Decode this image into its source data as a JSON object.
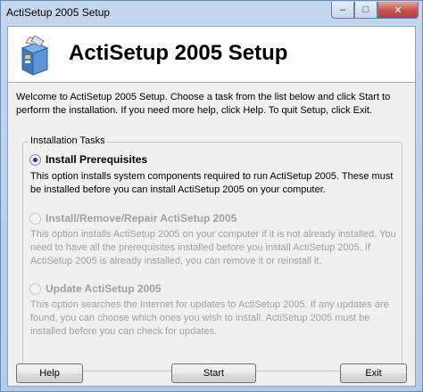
{
  "window": {
    "title": "ActiSetup 2005 Setup",
    "minimize_glyph": "–",
    "maximize_glyph": "□",
    "close_glyph": "✕"
  },
  "header": {
    "title": "ActiSetup 2005 Setup",
    "logo_icon": "box-install-icon"
  },
  "intro": "Welcome to ActiSetup 2005 Setup. Choose a task from the list below and click Start to perform the installation. If you need more help, click Help. To quit Setup, click Exit.",
  "tasks": {
    "legend": "Installation Tasks",
    "options": [
      {
        "label": "Install Prerequisites",
        "selected": true,
        "enabled": true,
        "description": "This option installs system components required to run ActiSetup 2005. These must be installed before you can install ActiSetup 2005 on your computer."
      },
      {
        "label": "Install/Remove/Repair ActiSetup 2005",
        "selected": false,
        "enabled": false,
        "description": "This option installs ActiSetup 2005 on your computer if it is not already installed. You need to have all the prerequisites installed before you install ActiSetup 2005. If ActiSetup 2005 is already installed, you can remove it or reinstall it."
      },
      {
        "label": "Update ActiSetup 2005",
        "selected": false,
        "enabled": false,
        "description": "This option searches the Internet for updates to ActiSetup 2005. If any updates are found, you can choose which ones you wish to install. ActiSetup 2005 must be installed before you can check for updates."
      }
    ]
  },
  "buttons": {
    "help": "Help",
    "start": "Start",
    "exit": "Exit"
  },
  "colors": {
    "accent": "#1b3f8f",
    "disabled_text": "#a0a0a0",
    "close_button": "#c75050"
  }
}
